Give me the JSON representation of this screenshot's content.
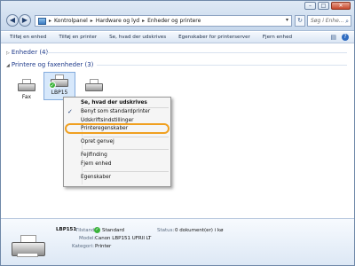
{
  "window": {
    "minimize": "–",
    "maximize": "□",
    "close": "✕"
  },
  "nav": {
    "back": "◀",
    "forward": "▶"
  },
  "address": {
    "crumbs": [
      "Kontrolpanel",
      "Hardware og lyd",
      "Enheder og printere"
    ],
    "separator": "▸",
    "dropdown": "▾",
    "refresh": "↻"
  },
  "search": {
    "placeholder": "Søg i Enhe...",
    "icon": "⌕"
  },
  "commandbar": {
    "items": [
      "Tilføj en enhed",
      "Tilføj en printer",
      "Se, hvad der udskrives",
      "Egenskaber for printerserver",
      "Fjern enhed"
    ],
    "view_icon": "▤",
    "help_icon": "?"
  },
  "groups": {
    "enheder": {
      "arrow": "▷",
      "label": "Enheder (4)"
    },
    "printere": {
      "arrow": "◢",
      "label": "Printere og faxenheder (3)"
    }
  },
  "devices": [
    {
      "label": "Fax"
    },
    {
      "label": "LBP15",
      "selected": true,
      "default": true,
      "badge": "✓"
    },
    {
      "label": ""
    }
  ],
  "context_menu": {
    "check_mark": "✓",
    "items": [
      {
        "label": "Se, hvad der udskrives",
        "bold": true
      },
      {
        "label": "Benyt som standardprinter",
        "checked": true
      },
      {
        "label": "Udskriftsindstillinger"
      },
      {
        "label": "Printeregenskaber",
        "highlighted": true
      },
      {
        "label": "Opret genvej"
      },
      {
        "label": "Fejlfinding"
      },
      {
        "label": "Fjern enhed"
      },
      {
        "label": "Egenskaber"
      }
    ]
  },
  "details": {
    "name": "LBP151",
    "status_label": "Tilstand:",
    "status_icon": "✓",
    "status_value": "Standard",
    "status2_label": "Status:",
    "status2_value": "0 dokument(er) i kø",
    "model_label": "Model:",
    "model_value": "Canon LBP151 UFRII LT",
    "category_label": "Kategori:",
    "category_value": "Printer"
  },
  "colors": {
    "highlight_ring": "#f0a020",
    "group_header": "#1e3a8a",
    "selection": "#d7e8fb"
  }
}
